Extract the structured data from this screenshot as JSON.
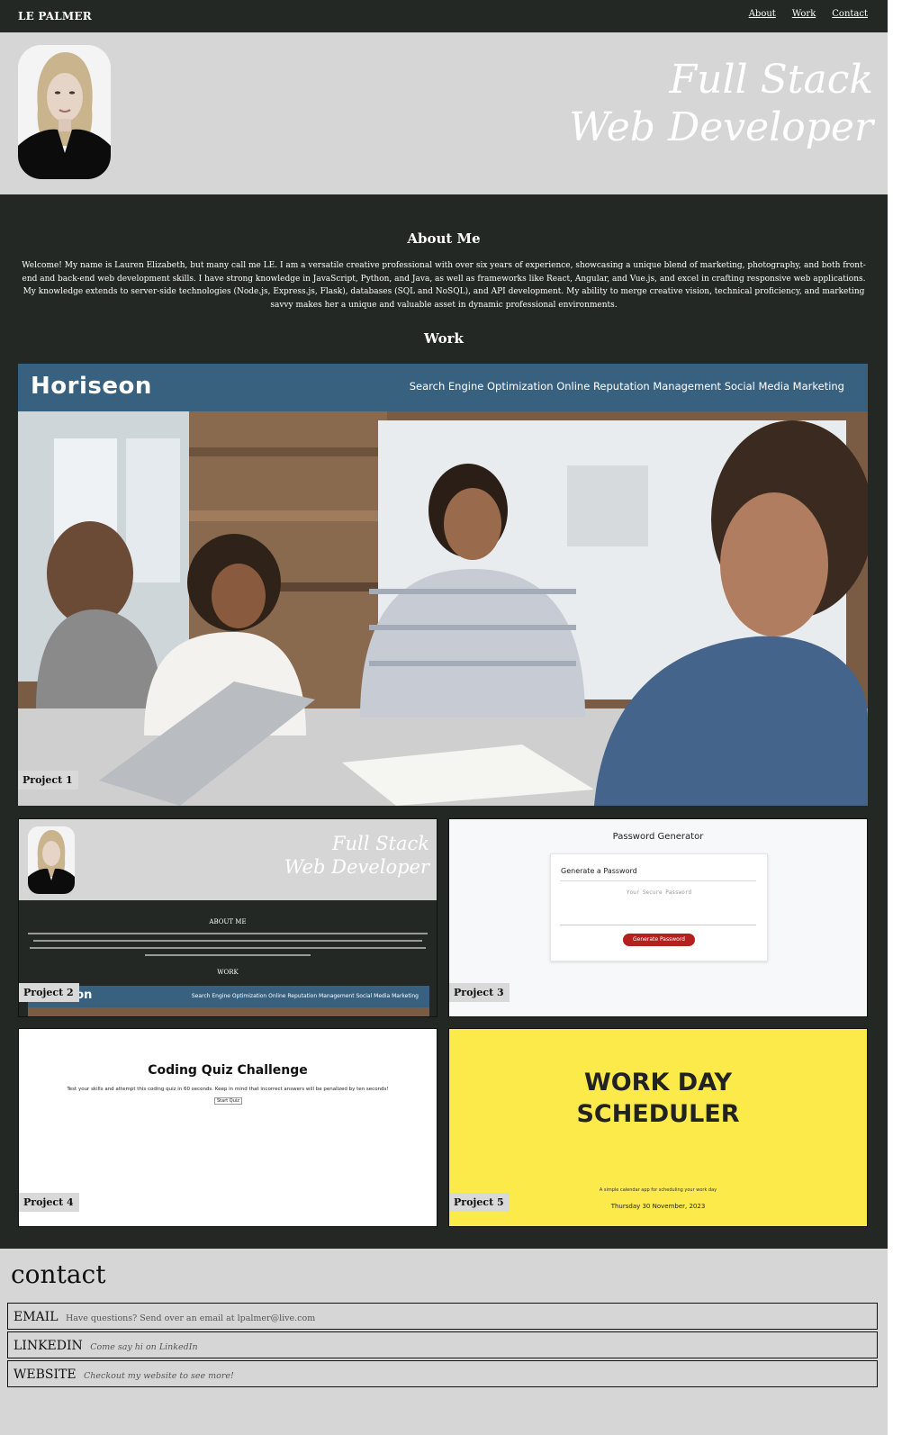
{
  "nav": {
    "brand": "LE PALMER",
    "links": [
      "About",
      "Work",
      "Contact"
    ]
  },
  "hero": {
    "title_line1": "Full Stack",
    "title_line2": "Web Developer"
  },
  "about": {
    "heading": "About Me",
    "text": "Welcome! My name is Lauren Elizabeth, but many call me LE. I am a versatile creative professional with over six years of experience, showcasing a unique blend of marketing, photography, and both front-end and back-end web development skills. I have strong knowledge in JavaScript, Python, and Java, as well as frameworks like React, Angular, and Vue.js, and excel in crafting responsive web applications. My knowledge extends to server-side technologies (Node.js, Express.js, Flask), databases (SQL and NoSQL), and API development. My ability to merge creative vision, technical proficiency, and marketing savvy makes her a unique and valuable asset in dynamic professional environments."
  },
  "work": {
    "heading": "Work",
    "projects": [
      {
        "label": "Project 1",
        "logo": "Horiseon",
        "menu": "Search Engine Optimization Online Reputation Management Social Media Marketing"
      },
      {
        "label": "Project 2",
        "title_line1": "Full Stack",
        "title_line2": "Web Developer",
        "about_heading": "ABOUT ME",
        "work_heading": "WORK",
        "logo": "Horiseon",
        "menu": "Search Engine Optimization Online Reputation Management Social Media Marketing"
      },
      {
        "label": "Project 3",
        "title": "Password Generator",
        "card_heading": "Generate a Password",
        "placeholder": "Your Secure Password",
        "button": "Generate Password"
      },
      {
        "label": "Project 4",
        "title": "Coding Quiz Challenge",
        "text": "Test your skills and attempt this coding quiz in 60 seconds. Keep in mind that incorrect answers will be penalized by ten seconds!",
        "button": "Start Quiz"
      },
      {
        "label": "Project 5",
        "title_line1": "WORK DAY",
        "title_line2": "SCHEDULER",
        "tagline": "A simple calendar app for scheduling your work day",
        "date": "Thursday 30 November, 2023"
      }
    ]
  },
  "contact": {
    "heading": "contact",
    "rows": [
      {
        "title": "EMAIL",
        "desc": "Have questions? Send over an email at lpalmer@live.com"
      },
      {
        "title": "LINKEDIN",
        "desc": "Come say hi on LinkedIn"
      },
      {
        "title": "WEBSITE",
        "desc": "Checkout my website to see more!"
      }
    ]
  },
  "colors": {
    "page_bg": "#232824",
    "hero_bg": "#d6d6d6",
    "horiseon_blue": "#386180",
    "scheduler_yellow": "#fbea4a",
    "generate_button": "#b3201e"
  }
}
